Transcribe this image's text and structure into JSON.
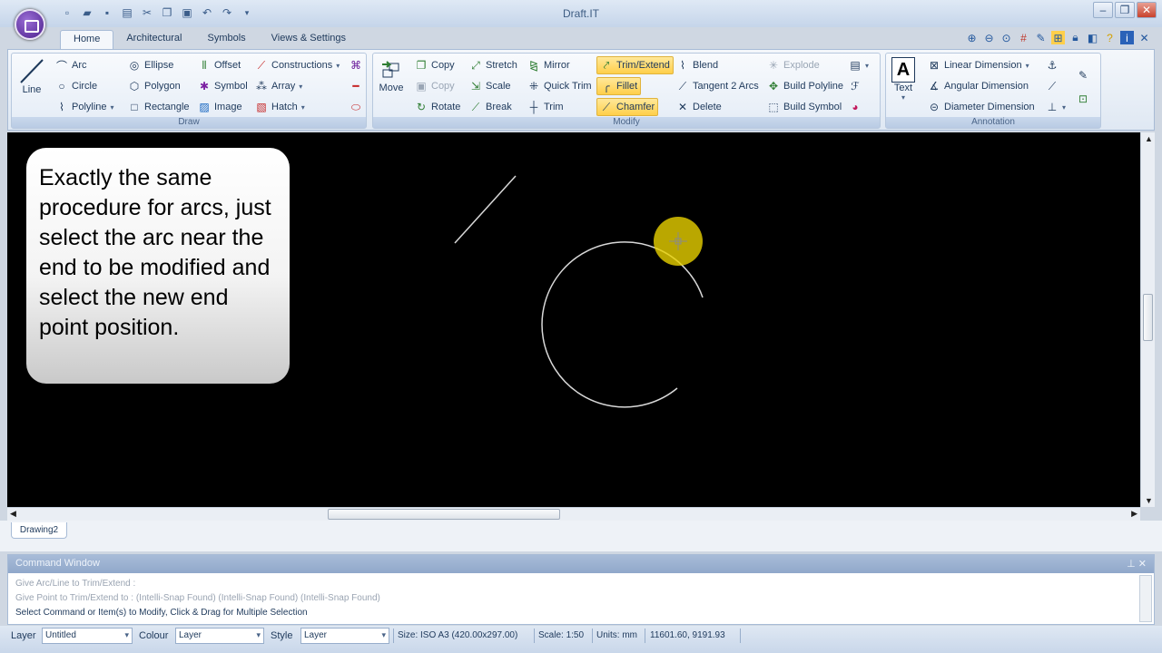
{
  "window": {
    "title": "Draft.IT"
  },
  "tabs": [
    "Home",
    "Architectural",
    "Symbols",
    "Views & Settings"
  ],
  "ribbon": {
    "draw": {
      "label": "Draw",
      "line": "Line",
      "arc": "Arc",
      "circle": "Circle",
      "polyline": "Polyline",
      "ellipse": "Ellipse",
      "polygon": "Polygon",
      "rectangle": "Rectangle",
      "offset": "Offset",
      "symbol": "Symbol",
      "image": "Image",
      "constructions": "Constructions",
      "array": "Array",
      "hatch": "Hatch"
    },
    "modify": {
      "label": "Modify",
      "move": "Move",
      "copy": "Copy",
      "copy2": "Copy",
      "rotate": "Rotate",
      "stretch": "Stretch",
      "scale": "Scale",
      "break": "Break",
      "mirror": "Mirror",
      "quick_trim": "Quick Trim",
      "trim": "Trim",
      "trim_extend": "Trim/Extend",
      "fillet": "Fillet",
      "chamfer": "Chamfer",
      "blend": "Blend",
      "tangent_2_arcs": "Tangent 2 Arcs",
      "delete": "Delete",
      "explode": "Explode",
      "build_polyline": "Build Polyline",
      "build_symbol": "Build Symbol"
    },
    "annotation": {
      "label": "Annotation",
      "text": "Text",
      "linear_dimension": "Linear Dimension",
      "angular_dimension": "Angular Dimension",
      "diameter_dimension": "Diameter Dimension"
    }
  },
  "callout": {
    "text": "Exactly the same procedure for arcs, just select the arc near the end to be modified and select the new end point position."
  },
  "doc_tab": "Drawing2",
  "command_window": {
    "title": "Command Window",
    "lines": [
      "Give Arc/Line to Trim/Extend :",
      "Give Point to Trim/Extend to :  (Intelli-Snap Found) (Intelli-Snap Found) (Intelli-Snap Found)",
      "Select Command or Item(s) to Modify, Click & Drag for Multiple Selection"
    ]
  },
  "status": {
    "layer_label": "Layer",
    "layer_value": "Untitled",
    "colour_label": "Colour",
    "colour_value": "Layer",
    "style_label": "Style",
    "style_value": "Layer",
    "size": "Size: ISO A3 (420.00x297.00)",
    "scale": "Scale: 1:50",
    "units": "Units: mm",
    "coords": "11601.60, 9191.93"
  },
  "colors": {
    "canvas": "#000000",
    "highlight": "#ffd24a",
    "cursor": "#e8d100"
  }
}
